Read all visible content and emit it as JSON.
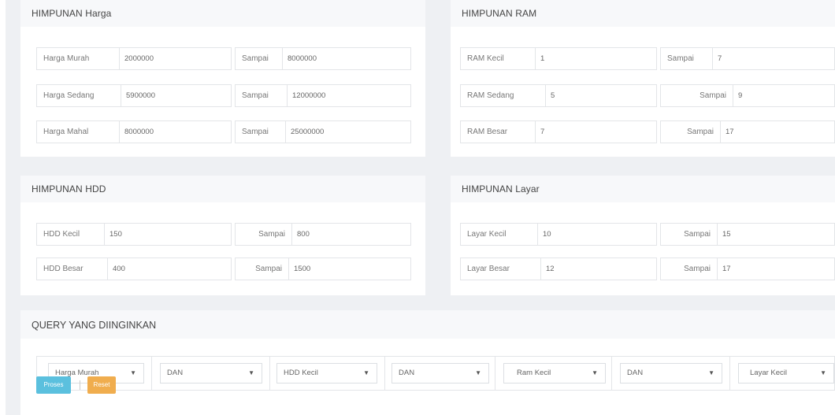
{
  "harga": {
    "title": "HIMPUNAN Harga",
    "rows": [
      {
        "label": "Harga Murah",
        "from": "2000000",
        "to_label": "Sampai",
        "to": "8000000"
      },
      {
        "label": "Harga Sedang",
        "from": "5900000",
        "to_label": "Sampai",
        "to": "12000000"
      },
      {
        "label": "Harga Mahal",
        "from": "8000000",
        "to_label": "Sampai",
        "to": "25000000"
      }
    ]
  },
  "ram": {
    "title": "HIMPUNAN RAM",
    "rows": [
      {
        "label": "RAM Kecil",
        "from": "1",
        "to_label": "Sampai",
        "to": "7"
      },
      {
        "label": "RAM Sedang",
        "from": "5",
        "to_label": "Sampai",
        "to": "9"
      },
      {
        "label": "RAM Besar",
        "from": "7",
        "to_label": "Sampai",
        "to": "17"
      }
    ]
  },
  "hdd": {
    "title": "HIMPUNAN HDD",
    "rows": [
      {
        "label": "HDD Kecil",
        "from": "150",
        "to_label": "Sampai",
        "to": "800"
      },
      {
        "label": "HDD Besar",
        "from": "400",
        "to_label": "Sampai",
        "to": "1500"
      }
    ]
  },
  "layar": {
    "title": "HIMPUNAN Layar",
    "rows": [
      {
        "label": "Layar Kecil",
        "from": "10",
        "to_label": "Sampai",
        "to": "15"
      },
      {
        "label": "Layar Besar",
        "from": "12",
        "to_label": "Sampai",
        "to": "17"
      }
    ]
  },
  "query": {
    "title": "QUERY YANG DIINGINKAN",
    "selects": [
      "Harga Murah",
      "DAN",
      "HDD Kecil",
      "DAN",
      "Ram Kecil",
      "DAN",
      "Layar Kecil"
    ],
    "caret": "▼"
  },
  "buttons": {
    "process": "Proses",
    "reset": "Reset"
  },
  "colors": {
    "process": "#5bc0de",
    "reset": "#f0ad4e",
    "background": "#eef0f3"
  }
}
